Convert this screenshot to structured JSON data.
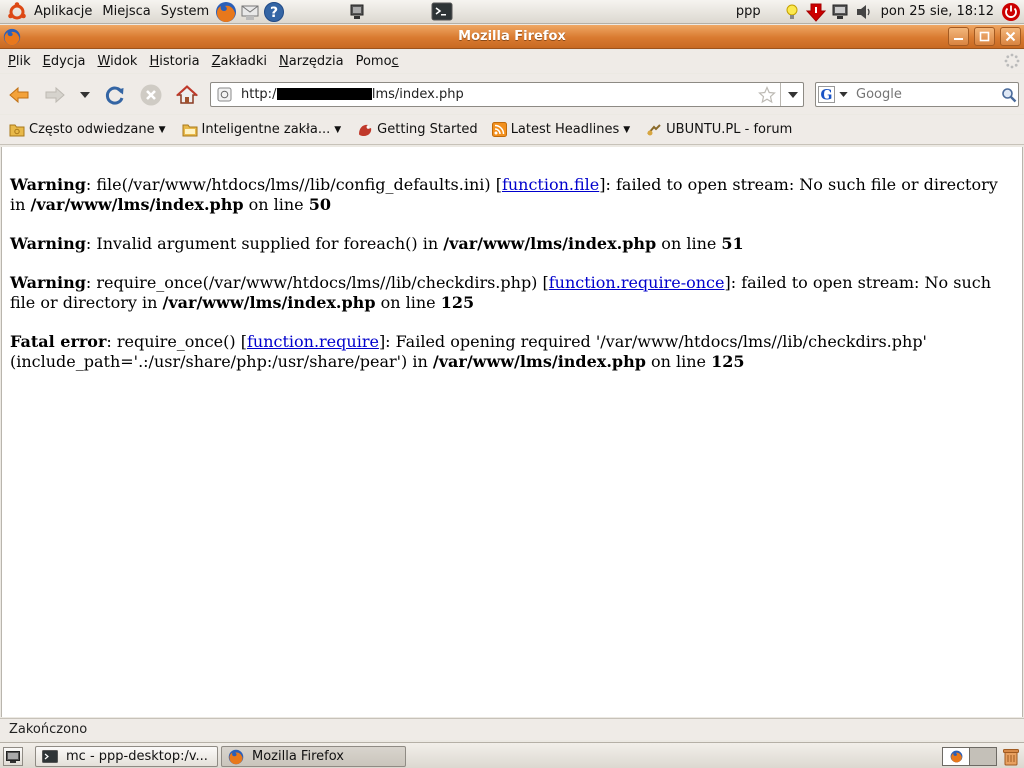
{
  "top_panel": {
    "menus": [
      "Aplikacje",
      "Miejsca",
      "System"
    ],
    "user": "ppp",
    "clock": "pon 25 sie, 18:12"
  },
  "window": {
    "title": "Mozilla Firefox"
  },
  "menubar": [
    {
      "pre": "",
      "ul": "P",
      "post": "lik"
    },
    {
      "pre": "",
      "ul": "E",
      "post": "dycja"
    },
    {
      "pre": "",
      "ul": "W",
      "post": "idok"
    },
    {
      "pre": "",
      "ul": "H",
      "post": "istoria"
    },
    {
      "pre": "",
      "ul": "Z",
      "post": "akładki"
    },
    {
      "pre": "",
      "ul": "N",
      "post": "arzędzia"
    },
    {
      "pre": "Pomo",
      "ul": "c",
      "post": ""
    }
  ],
  "navbar": {
    "url_prefix": "http:/",
    "url_suffix": "/lms/index.php",
    "search_placeholder": "Google"
  },
  "bookmarks": {
    "items": [
      {
        "label": "Często odwiedzane",
        "dropdown": true
      },
      {
        "label": "Inteligentne zakła...",
        "dropdown": true
      },
      {
        "label": "Getting Started",
        "dropdown": false
      },
      {
        "label": "Latest Headlines",
        "dropdown": true
      },
      {
        "label": "UBUNTU.PL - forum",
        "dropdown": false
      }
    ]
  },
  "content": {
    "msg1": {
      "type": "Warning",
      "text_a": ": file(/var/www/htdocs/lms//lib/config_defaults.ini) [",
      "link": "function.file",
      "text_b": "]: failed to open stream: No such file or directory in ",
      "path": "/var/www/lms/index.php",
      "text_c": " on line ",
      "line": "50"
    },
    "msg2": {
      "type": "Warning",
      "text_a": ": Invalid argument supplied for foreach() in ",
      "path": "/var/www/lms/index.php",
      "text_c": " on line ",
      "line": "51"
    },
    "msg3": {
      "type": "Warning",
      "text_a": ": require_once(/var/www/htdocs/lms//lib/checkdirs.php) [",
      "link": "function.require-once",
      "text_b": "]: failed to open stream: No such file or directory in ",
      "path": "/var/www/lms/index.php",
      "text_c": " on line ",
      "line": "125"
    },
    "msg4": {
      "type": "Fatal error",
      "text_a": ": require_once() [",
      "link": "function.require",
      "text_b": "]: Failed opening required '/var/www/htdocs/lms//lib/checkdirs.php' (include_path='.:/usr/share/php:/usr/share/pear') in ",
      "path": "/var/www/lms/index.php",
      "text_c": " on line ",
      "line": "125"
    }
  },
  "statusbar": {
    "text": "Zakończono"
  },
  "taskbar": {
    "tasks": [
      "mc - ppp-desktop:/v...",
      "Mozilla Firefox"
    ]
  },
  "colors": {
    "titlebar": "#d97a30",
    "link": "#0000cc"
  }
}
